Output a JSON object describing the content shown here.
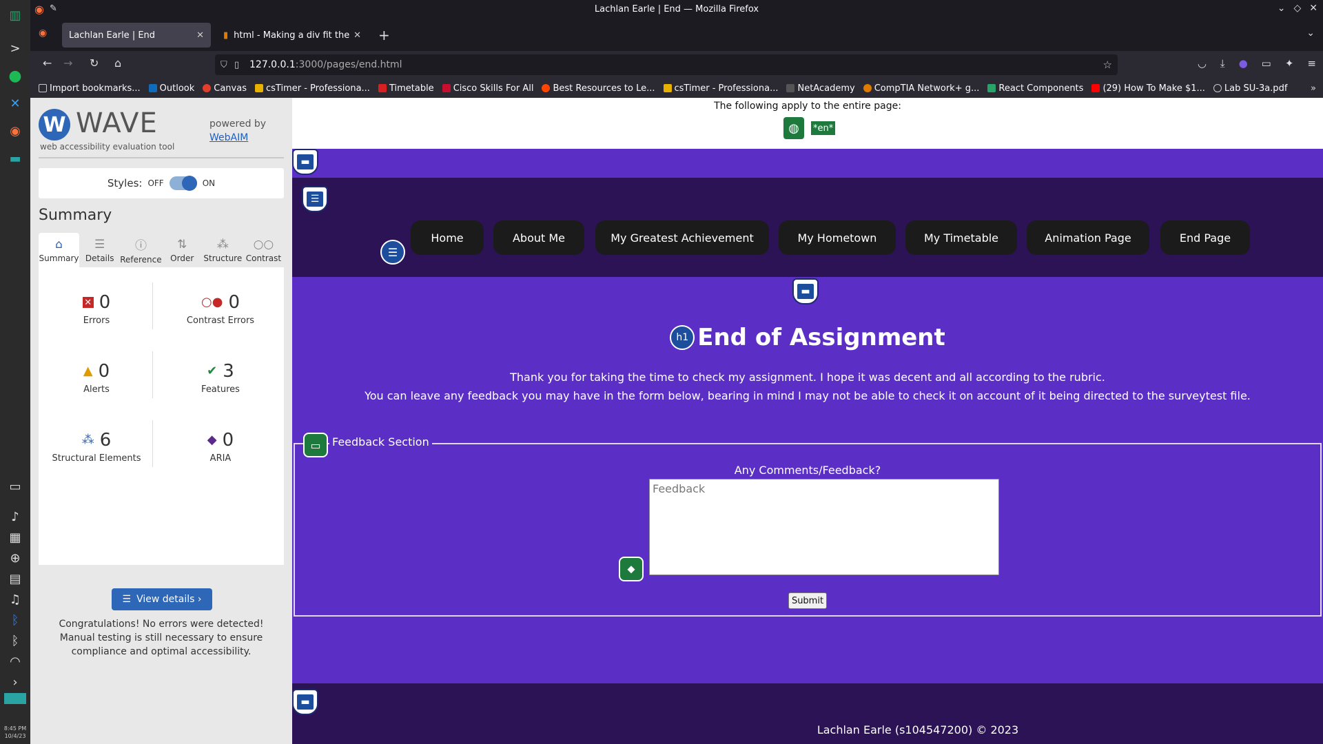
{
  "window": {
    "title": "Lachlan Earle | End — Mozilla Firefox"
  },
  "tabs": [
    {
      "label": "Lachlan Earle | End",
      "active": true
    },
    {
      "label": "html - Making a div fit the i",
      "active": false
    }
  ],
  "url": {
    "host": "127.0.0.1",
    "rest": ":3000/pages/end.html"
  },
  "bookmarks": [
    {
      "label": "Import bookmarks...",
      "color": "#cccccc"
    },
    {
      "label": "Outlook",
      "color": "#0f6cbd"
    },
    {
      "label": "Canvas",
      "color": "#e13f2b"
    },
    {
      "label": "csTimer - Professiona...",
      "color": "#e8b100"
    },
    {
      "label": "Timetable",
      "color": "#d92020"
    },
    {
      "label": "Cisco Skills For All",
      "color": "#c8102e"
    },
    {
      "label": "Best Resources to Le...",
      "color": "#ff4500"
    },
    {
      "label": "csTimer - Professiona...",
      "color": "#e8b100"
    },
    {
      "label": "NetAcademy",
      "color": "#555555"
    },
    {
      "label": "CompTIA Network+ g...",
      "color": "#e07b00"
    },
    {
      "label": "React Components",
      "color": "#2aa36b"
    },
    {
      "label": "(29) How To Make $1...",
      "color": "#ff0000"
    },
    {
      "label": "Lab SU-3a.pdf",
      "color": "#cccccc"
    }
  ],
  "os": {
    "time": "8:45 PM",
    "date": "10/4/23"
  },
  "wave": {
    "name": "WAVE",
    "subtitle": "web accessibility evaluation tool",
    "powered_by": "powered by",
    "webaim": "WebAIM",
    "styles_label": "Styles:",
    "styles_off": "OFF",
    "styles_on": "ON",
    "summary_title": "Summary",
    "tabs": [
      {
        "label": "Summary",
        "icon": "home-icon"
      },
      {
        "label": "Details",
        "icon": "list-icon"
      },
      {
        "label": "Reference",
        "icon": "info-icon"
      },
      {
        "label": "Order",
        "icon": "order-icon"
      },
      {
        "label": "Structure",
        "icon": "structure-icon"
      },
      {
        "label": "Contrast",
        "icon": "contrast-icon"
      }
    ],
    "stats": {
      "errors": {
        "value": "0",
        "label": "Errors"
      },
      "contrast": {
        "value": "0",
        "label": "Contrast Errors"
      },
      "alerts": {
        "value": "0",
        "label": "Alerts"
      },
      "features": {
        "value": "3",
        "label": "Features"
      },
      "structural": {
        "value": "6",
        "label": "Structural Elements"
      },
      "aria": {
        "value": "0",
        "label": "ARIA"
      }
    },
    "view_details": "View details ›",
    "congrats": "Congratulations! No errors were detected! Manual testing is still necessary to ensure compliance and optimal accessibility."
  },
  "page": {
    "top_info": "The following apply to the entire page:",
    "lang_badge": "*en*",
    "nav": [
      "Home",
      "About Me",
      "My Greatest Achievement",
      "My Hometown",
      "My Timetable",
      "Animation Page",
      "End Page"
    ],
    "h1_badge": "h1",
    "heading": "End of Assignment",
    "para1": "Thank you for taking the time to check my assignment. I hope it was decent and all according to the rubric.",
    "para2": "You can leave any feedback you may have in the form below, bearing in mind I may not be able to check it on account of it being directed to the surveytest file.",
    "legend": "Feedback Section",
    "feedback_label": "Any Comments/Feedback?",
    "feedback_placeholder": "Feedback",
    "submit": "Submit",
    "footer": "Lachlan Earle (s104547200) © 2023"
  },
  "colors": {
    "page_bg": "#5b2ec6",
    "header_bg": "#2b1356",
    "wave_blue": "#2e66b8",
    "wave_green": "#1e7a3c"
  }
}
